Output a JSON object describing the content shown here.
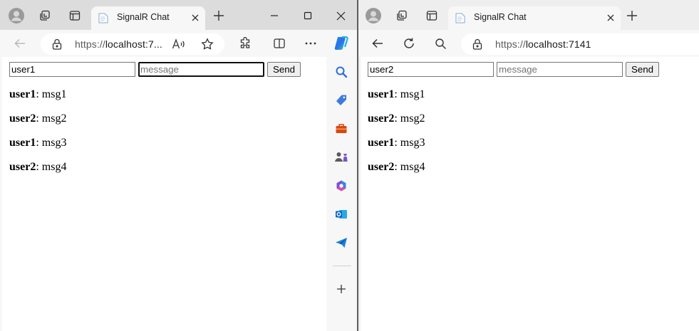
{
  "left_window": {
    "tab": {
      "title": "SignalR Chat"
    },
    "address": {
      "scheme": "https://",
      "host": "localhost:7..."
    },
    "form": {
      "user_value": "user1",
      "message_placeholder": "message",
      "send_label": "Send"
    },
    "messages": [
      {
        "user": "user1",
        "text": ": msg1"
      },
      {
        "user": "user2",
        "text": ": msg2"
      },
      {
        "user": "user1",
        "text": ": msg3"
      },
      {
        "user": "user2",
        "text": ": msg4"
      }
    ],
    "sidebar_icons": [
      "search-icon",
      "shopping-tag-icon",
      "tools-icon",
      "games-icon",
      "microsoft-365-icon",
      "outlook-icon",
      "send-icon",
      "add-icon"
    ]
  },
  "right_window": {
    "tab": {
      "title": "SignalR Chat"
    },
    "address": {
      "scheme": "https://",
      "host": "localhost:7141"
    },
    "form": {
      "user_value": "user2",
      "message_placeholder": "message",
      "send_label": "Send"
    },
    "messages": [
      {
        "user": "user1",
        "text": ": msg1"
      },
      {
        "user": "user2",
        "text": ": msg2"
      },
      {
        "user": "user1",
        "text": ": msg3"
      },
      {
        "user": "user2",
        "text": ": msg4"
      }
    ]
  },
  "colors": {
    "left_tabstrip": "#dcdcdc",
    "right_tabstrip": "#eeeeee",
    "toolbar": "#f7f7f7",
    "copilot_gradient": [
      "#1a8cff",
      "#2ed0c3"
    ],
    "shopping_tag": "#3d7be0",
    "tools": "#d9480f",
    "outlook": "#0a64c8"
  }
}
